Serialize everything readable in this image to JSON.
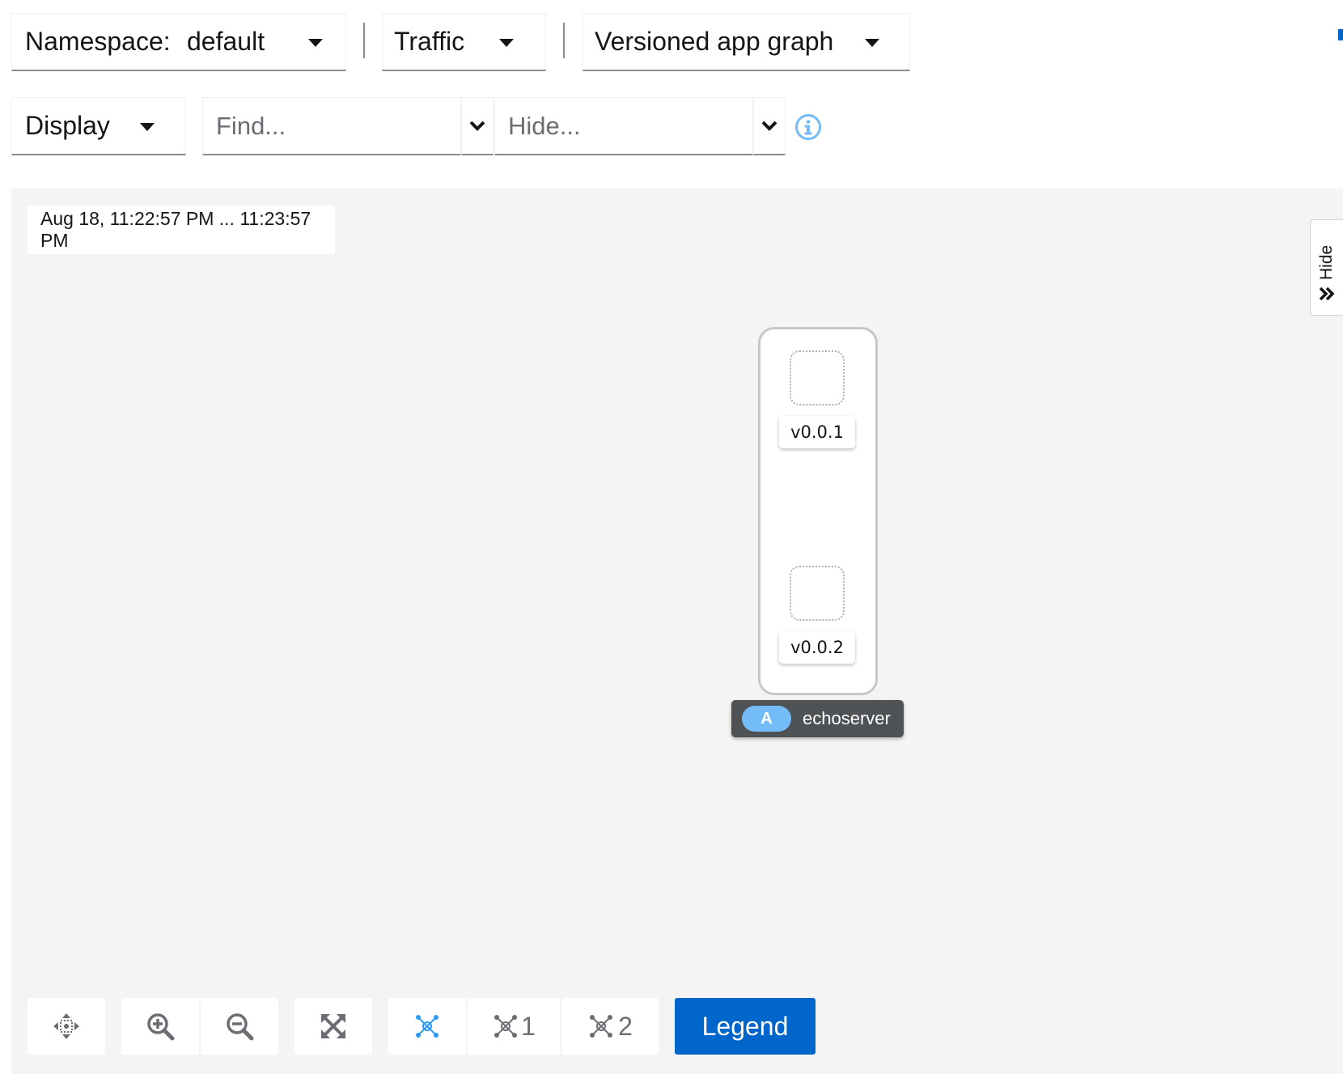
{
  "toolbar": {
    "namespace": {
      "label": "Namespace:",
      "value": "default"
    },
    "traffic": {
      "label": "Traffic"
    },
    "graph_type": {
      "label": "Versioned app graph"
    },
    "display": {
      "label": "Display"
    },
    "find": {
      "placeholder": "Find..."
    },
    "hide": {
      "placeholder": "Hide..."
    },
    "info_icon": "info-circle-icon"
  },
  "graph": {
    "time_range": "Aug 18, 11:22:57 PM ... 11:23:57 PM",
    "side_panel_toggle": {
      "label": "Hide",
      "icon": "angle-double-right-icon"
    },
    "app": {
      "badge": "A",
      "name": "echoserver",
      "versions": [
        {
          "label": "v0.0.1"
        },
        {
          "label": "v0.0.2"
        }
      ]
    }
  },
  "bottom_toolbar": {
    "pan_icon": "arrows-move-icon",
    "zoom_in_icon": "zoom-in-icon",
    "zoom_out_icon": "zoom-out-icon",
    "fit_icon": "expand-icon",
    "layout_default": {
      "icon": "topology-icon",
      "label": ""
    },
    "layout_1": {
      "icon": "topology-icon",
      "label": "1"
    },
    "layout_2": {
      "icon": "topology-icon",
      "label": "2"
    },
    "legend_label": "Legend"
  },
  "colors": {
    "primary": "#0066cc",
    "graph_background": "#f4f4f4",
    "badge": "#73bcf7",
    "app_label_background": "#4f5255",
    "active_layout_icon": "#2b9af3"
  }
}
